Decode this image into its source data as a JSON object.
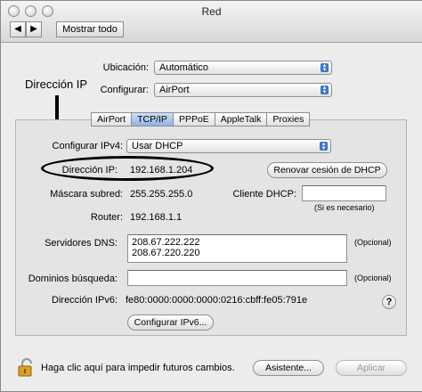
{
  "window": {
    "title": "Red"
  },
  "toolbar": {
    "back_glyph": "◀",
    "forward_glyph": "▶",
    "show_all_label": "Mostrar todo"
  },
  "top": {
    "location_label": "Ubicación:",
    "location_value": "Automático",
    "configure_label": "Configurar:",
    "configure_value": "AirPort"
  },
  "tabs": [
    {
      "label": "AirPort",
      "selected": false
    },
    {
      "label": "TCP/IP",
      "selected": true
    },
    {
      "label": "PPPoE",
      "selected": false
    },
    {
      "label": "AppleTalk",
      "selected": false
    },
    {
      "label": "Proxies",
      "selected": false
    }
  ],
  "tcpip": {
    "ipv4_label": "Configurar IPv4:",
    "ipv4_value": "Usar DHCP",
    "ip_label": "Dirección IP:",
    "ip_value": "192.168.1.204",
    "renew_button": "Renovar cesión de DHCP",
    "subnet_label": "Máscara subred:",
    "subnet_value": "255.255.255.0",
    "client_label": "Cliente DHCP:",
    "client_value": "",
    "client_hint": "(Si es necesario)",
    "router_label": "Router:",
    "router_value": "192.168.1.1",
    "dns_label": "Servidores DNS:",
    "dns_values": [
      "208.67.222.222",
      "208.67.220.220"
    ],
    "dns_hint": "(Opcional)",
    "search_label": "Dominios búsqueda:",
    "search_value": "",
    "search_hint": "(Opcional)",
    "ipv6_label": "Dirección IPv6:",
    "ipv6_value": "fe80:0000:0000:0000:0216:cbff:fe05:791e",
    "ipv6_button": "Configurar IPv6...",
    "help_glyph": "?"
  },
  "footer": {
    "lock_text": "Haga clic aquí para impedir futuros cambios.",
    "assistant_button": "Asistente...",
    "apply_button": "Aplicar"
  },
  "annotation": {
    "label": "Dirección IP"
  },
  "colors": {
    "accent": "#3a76c9",
    "window_bg": "#ececec"
  }
}
